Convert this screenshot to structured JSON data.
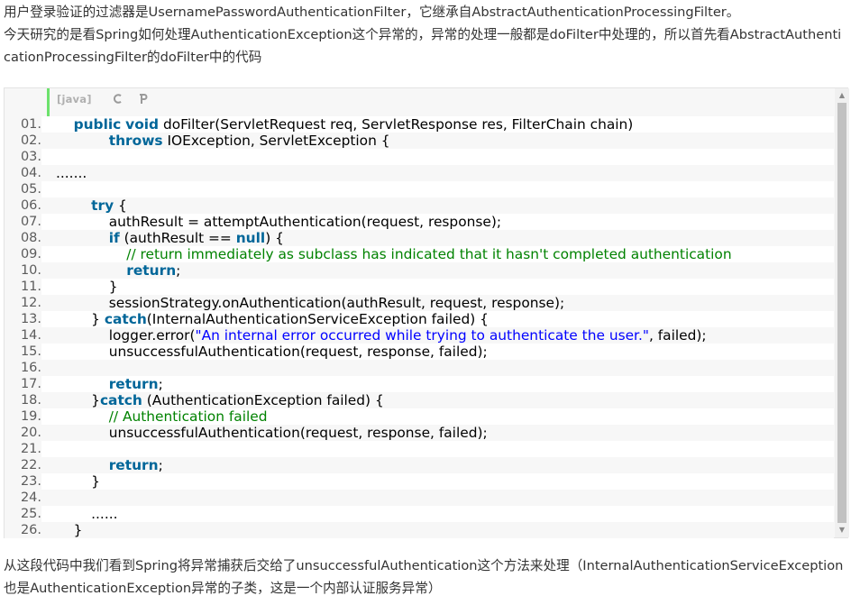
{
  "intro": {
    "text": "用户登录验证的过滤器是UsernamePasswordAuthenticationFilter，它继承自AbstractAuthenticationProcessingFilter。\n今天研究的是看Spring如何处理AuthenticationException这个异常的，异常的处理一般都是doFilter中处理的，所以首先看AbstractAuthenticationProcessingFilter的doFilter中的代码"
  },
  "toolbar": {
    "language": "[java]",
    "copy_icon": "copy-icon",
    "print_icon": "print-icon"
  },
  "code": {
    "lines": [
      {
        "num": "01.",
        "tokens": [
          [
            "",
            "    "
          ],
          [
            "kw",
            "public"
          ],
          [
            "",
            " "
          ],
          [
            "kw",
            "void"
          ],
          [
            "",
            " doFilter(ServletRequest req, ServletResponse res, FilterChain chain)"
          ]
        ]
      },
      {
        "num": "02.",
        "tokens": [
          [
            "",
            "            "
          ],
          [
            "kw",
            "throws"
          ],
          [
            "",
            " IOException, ServletException {"
          ]
        ]
      },
      {
        "num": "03.",
        "tokens": []
      },
      {
        "num": "04.",
        "tokens": [
          [
            "",
            "......."
          ]
        ]
      },
      {
        "num": "05.",
        "tokens": []
      },
      {
        "num": "06.",
        "tokens": [
          [
            "",
            "        "
          ],
          [
            "kw",
            "try"
          ],
          [
            "",
            " {"
          ]
        ]
      },
      {
        "num": "07.",
        "tokens": [
          [
            "",
            "            authResult = attemptAuthentication(request, response);"
          ]
        ]
      },
      {
        "num": "08.",
        "tokens": [
          [
            "",
            "            "
          ],
          [
            "kw",
            "if"
          ],
          [
            "",
            " (authResult == "
          ],
          [
            "kw",
            "null"
          ],
          [
            "",
            ") {"
          ]
        ]
      },
      {
        "num": "09.",
        "tokens": [
          [
            "",
            "                "
          ],
          [
            "cm",
            "// return immediately as subclass has indicated that it hasn't completed authentication"
          ]
        ]
      },
      {
        "num": "10.",
        "tokens": [
          [
            "",
            "                "
          ],
          [
            "kw",
            "return"
          ],
          [
            "",
            ";"
          ]
        ]
      },
      {
        "num": "11.",
        "tokens": [
          [
            "",
            "            }"
          ]
        ]
      },
      {
        "num": "12.",
        "tokens": [
          [
            "",
            "            sessionStrategy.onAuthentication(authResult, request, response);"
          ]
        ]
      },
      {
        "num": "13.",
        "tokens": [
          [
            "",
            "        } "
          ],
          [
            "kw",
            "catch"
          ],
          [
            "",
            "(InternalAuthenticationServiceException failed) {"
          ]
        ]
      },
      {
        "num": "14.",
        "tokens": [
          [
            "",
            "            logger.error("
          ],
          [
            "str",
            "\"An internal error occurred while trying to authenticate the user.\""
          ],
          [
            "",
            ", failed);"
          ]
        ]
      },
      {
        "num": "15.",
        "tokens": [
          [
            "",
            "            unsuccessfulAuthentication(request, response, failed);"
          ]
        ]
      },
      {
        "num": "16.",
        "tokens": []
      },
      {
        "num": "17.",
        "tokens": [
          [
            "",
            "            "
          ],
          [
            "kw",
            "return"
          ],
          [
            "",
            ";"
          ]
        ]
      },
      {
        "num": "18.",
        "tokens": [
          [
            "",
            "        }"
          ],
          [
            "kw",
            "catch"
          ],
          [
            "",
            " (AuthenticationException failed) {"
          ]
        ]
      },
      {
        "num": "19.",
        "tokens": [
          [
            "",
            "            "
          ],
          [
            "cm",
            "// Authentication failed"
          ]
        ]
      },
      {
        "num": "20.",
        "tokens": [
          [
            "",
            "            unsuccessfulAuthentication(request, response, failed);"
          ]
        ]
      },
      {
        "num": "21.",
        "tokens": []
      },
      {
        "num": "22.",
        "tokens": [
          [
            "",
            "            "
          ],
          [
            "kw",
            "return"
          ],
          [
            "",
            ";"
          ]
        ]
      },
      {
        "num": "23.",
        "tokens": [
          [
            "",
            "        }"
          ]
        ]
      },
      {
        "num": "24.",
        "tokens": []
      },
      {
        "num": "25.",
        "tokens": [
          [
            "",
            "        ......"
          ]
        ]
      },
      {
        "num": "26.",
        "tokens": [
          [
            "",
            "    }"
          ]
        ]
      }
    ]
  },
  "outro": {
    "text": "从这段代码中我们看到Spring将异常捕获后交给了unsuccessfulAuthentication这个方法来处理（InternalAuthenticationServiceException也是AuthenticationException异常的子类，这是一个内部认证服务异常）"
  },
  "colors": {
    "keyword": "#006699",
    "string": "#0000ff",
    "comment": "#008200",
    "gutter_accent": "#6ce26c"
  }
}
